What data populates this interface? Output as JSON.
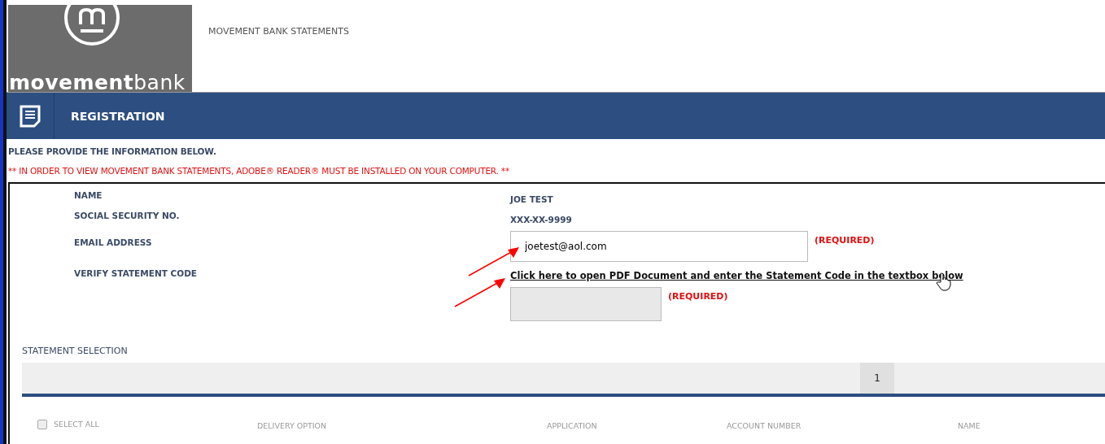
{
  "header": {
    "logo_text_bold": "movement",
    "logo_text_light": "bank",
    "title": "MOVEMENT BANK STATEMENTS"
  },
  "bar": {
    "title": "REGISTRATION"
  },
  "intro": "PLEASE PROVIDE THE INFORMATION BELOW.",
  "notice": "** IN ORDER TO VIEW MOVEMENT BANK STATEMENTS, ADOBE® READER® MUST BE INSTALLED ON YOUR COMPUTER. **",
  "form": [
    {
      "kind": "text",
      "label": "NAME",
      "value": "JOE TEST"
    },
    {
      "kind": "text",
      "label": "SOCIAL SECURITY NO.",
      "value": "XXX-XX-9999"
    },
    {
      "kind": "input",
      "label": "EMAIL ADDRESS",
      "value": "joetest@aol.com",
      "note": "(REQUIRED)"
    },
    {
      "kind": "code",
      "label": "VERIFY STATEMENT CODE",
      "link": "Click here to open PDF Document and enter the Statement Code in the textbox below",
      "note": "(REQUIRED)"
    }
  ],
  "statement_selection": {
    "title": "STATEMENT SELECTION",
    "pages": [
      {
        "label": "1",
        "selected": true
      }
    ],
    "select_all": {
      "label": "SELECT ALL",
      "checked": false
    },
    "columns": [
      "DELIVERY OPTION",
      "APPLICATION",
      "ACCOUNT NUMBER",
      "NAME"
    ]
  }
}
